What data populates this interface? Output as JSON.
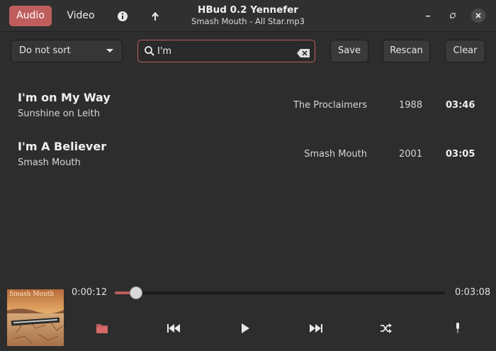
{
  "window": {
    "title": "HBud 0.2 Yennefer",
    "subtitle": "Smash Mouth - All Star.mp3"
  },
  "header": {
    "tabs": [
      {
        "label": "Audio",
        "active": true
      },
      {
        "label": "Video",
        "active": false
      }
    ],
    "icons": [
      "info-icon",
      "up-arrow-icon"
    ]
  },
  "toolbar": {
    "sort_value": "Do not sort",
    "search_value": "I'm",
    "save_label": "Save",
    "rescan_label": "Rescan",
    "clear_label": "Clear"
  },
  "tracks": [
    {
      "title": "I'm on My Way",
      "album": "Sunshine on Leith",
      "artist": "The Proclaimers",
      "year": "1988",
      "duration": "03:46"
    },
    {
      "title": "I'm A Believer",
      "album": "Smash Mouth",
      "artist": "Smash Mouth",
      "year": "2001",
      "duration": "03:05"
    }
  ],
  "player": {
    "current_time": "0:00:12",
    "total_time": "0:03:08",
    "progress": 0.064,
    "cover_text": "Smash Mouth",
    "controls": [
      "folder-icon",
      "previous-icon",
      "play-icon",
      "next-icon",
      "shuffle-icon",
      "microphone-icon"
    ]
  },
  "colors": {
    "accent": "#c05d5d",
    "background": "#2d2d2d"
  }
}
